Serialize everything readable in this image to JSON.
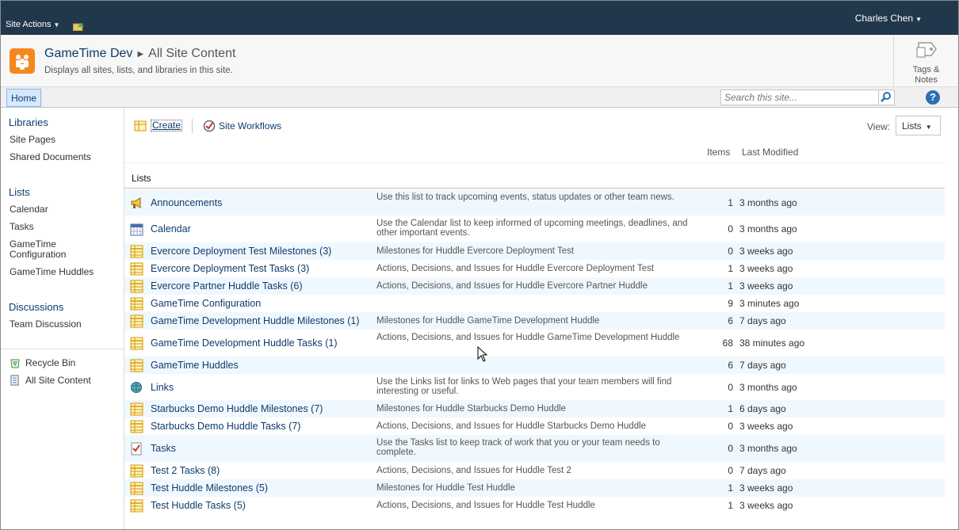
{
  "ribbon": {
    "site_actions": "Site Actions",
    "user_name": "Charles Chen"
  },
  "title_area": {
    "site_name": "GameTime Dev",
    "page_name": "All Site Content",
    "description": "Displays all sites, lists, and libraries in this site.",
    "tags_label_line1": "Tags &",
    "tags_label_line2": "Notes"
  },
  "top_nav": {
    "home": "Home",
    "search_placeholder": "Search this site..."
  },
  "left_nav": {
    "libraries_heading": "Libraries",
    "libraries": [
      "Site Pages",
      "Shared Documents"
    ],
    "lists_heading": "Lists",
    "lists": [
      "Calendar",
      "Tasks",
      "GameTime Configuration",
      "GameTime Huddles"
    ],
    "discussions_heading": "Discussions",
    "discussions": [
      "Team Discussion"
    ],
    "recycle_bin": "Recycle Bin",
    "all_site_content": "All Site Content"
  },
  "toolbar": {
    "create": "Create",
    "site_workflows": "Site Workflows",
    "view_label": "View:",
    "view_value": "Lists"
  },
  "columns": {
    "items": "Items",
    "last_modified": "Last Modified"
  },
  "section_title": "Lists",
  "lists": [
    {
      "icon": "announcement-icon",
      "name": "Announcements",
      "desc": "Use this list to track upcoming events, status updates or other team news.",
      "items": "1",
      "modified": "3 months ago"
    },
    {
      "icon": "calendar-icon",
      "name": "Calendar",
      "desc": "Use the Calendar list to keep informed of upcoming meetings, deadlines, and other important events.",
      "items": "0",
      "modified": "3 months ago"
    },
    {
      "icon": "list-icon",
      "name": "Evercore Deployment Test Milestones (3)",
      "desc": "Milestones for Huddle Evercore Deployment Test",
      "items": "0",
      "modified": "3 weeks ago"
    },
    {
      "icon": "list-icon",
      "name": "Evercore Deployment Test Tasks (3)",
      "desc": "Actions, Decisions, and Issues for Huddle Evercore Deployment Test",
      "items": "1",
      "modified": "3 weeks ago"
    },
    {
      "icon": "list-icon",
      "name": "Evercore Partner Huddle Tasks (6)",
      "desc": "Actions, Decisions, and Issues for Huddle Evercore Partner Huddle",
      "items": "1",
      "modified": "3 weeks ago"
    },
    {
      "icon": "list-icon",
      "name": "GameTime Configuration",
      "desc": "",
      "items": "9",
      "modified": "3 minutes ago"
    },
    {
      "icon": "list-icon",
      "name": "GameTime Development Huddle Milestones (1)",
      "desc": "Milestones for Huddle GameTime Development Huddle",
      "items": "6",
      "modified": "7 days ago"
    },
    {
      "icon": "list-icon",
      "name": "GameTime Development Huddle Tasks (1)",
      "desc": "Actions, Decisions, and Issues for Huddle GameTime Development Huddle",
      "items": "68",
      "modified": "38 minutes ago"
    },
    {
      "icon": "list-icon",
      "name": "GameTime Huddles",
      "desc": "",
      "items": "6",
      "modified": "7 days ago"
    },
    {
      "icon": "links-icon",
      "name": "Links",
      "desc": "Use the Links list for links to Web pages that your team members will find interesting or useful.",
      "items": "0",
      "modified": "3 months ago"
    },
    {
      "icon": "list-icon",
      "name": "Starbucks Demo Huddle Milestones (7)",
      "desc": "Milestones for Huddle Starbucks Demo Huddle",
      "items": "1",
      "modified": "6 days ago"
    },
    {
      "icon": "list-icon",
      "name": "Starbucks Demo Huddle Tasks (7)",
      "desc": "Actions, Decisions, and Issues for Huddle Starbucks Demo Huddle",
      "items": "0",
      "modified": "3 weeks ago"
    },
    {
      "icon": "tasks-icon",
      "name": "Tasks",
      "desc": "Use the Tasks list to keep track of work that you or your team needs to complete.",
      "items": "0",
      "modified": "3 months ago"
    },
    {
      "icon": "list-icon",
      "name": "Test 2 Tasks (8)",
      "desc": "Actions, Decisions, and Issues for Huddle Test 2",
      "items": "0",
      "modified": "7 days ago"
    },
    {
      "icon": "list-icon",
      "name": "Test Huddle Milestones (5)",
      "desc": "Milestones for Huddle Test Huddle",
      "items": "1",
      "modified": "3 weeks ago"
    },
    {
      "icon": "list-icon",
      "name": "Test Huddle Tasks (5)",
      "desc": "Actions, Decisions, and Issues for Huddle Test Huddle",
      "items": "1",
      "modified": "3 weeks ago"
    }
  ],
  "colors": {
    "ribbon_bg": "#21374c",
    "link": "#0f3b6b",
    "row_alt": "#f0f8ff",
    "logo": "#f6871f"
  }
}
